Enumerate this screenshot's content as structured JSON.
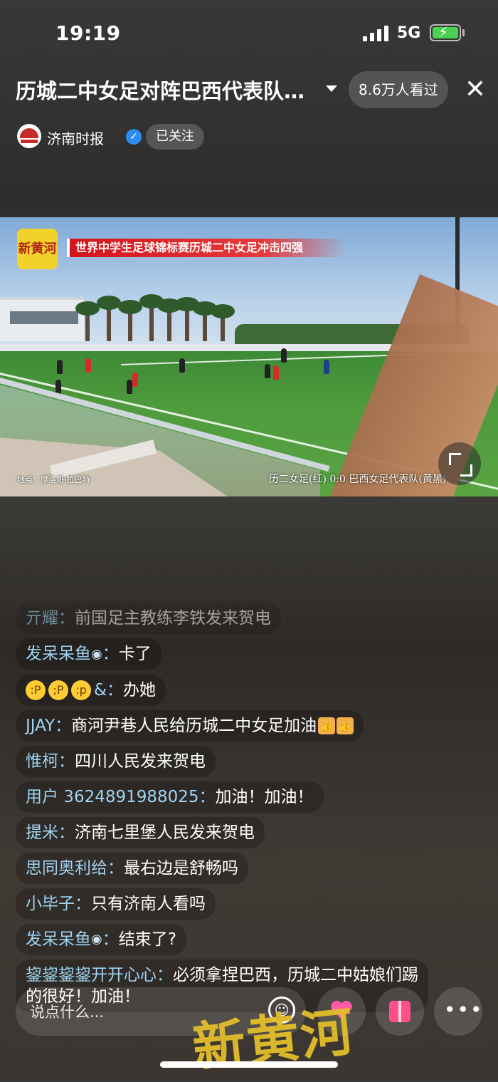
{
  "status_bar": {
    "time": "19:19",
    "network": "5G"
  },
  "header": {
    "title": "历城二中女足对阵巴西代表队…",
    "viewers": "8.6万人看过",
    "close_icon": "close-icon"
  },
  "channel": {
    "name": "济南时报",
    "follow_label": "已关注"
  },
  "video": {
    "logo_text": "新黄河",
    "headline": "世界中学生足球锦标赛历城二中女足冲击四强",
    "location": "地点：摩洛哥·拉巴特",
    "score": "历二女足(红) 0:0 巴西女足代表队(黄黑)"
  },
  "chat": [
    {
      "user": "亓耀",
      "text": "前国足主教练李铁发来贺电",
      "faded": true
    },
    {
      "user": "发呆呆鱼",
      "suffix_icon": "fish-icon",
      "text": "卡了"
    },
    {
      "user": "&",
      "prefix_emojis": [
        "crazy-face-emoji",
        "winking-tongue-emoji",
        "tongue-emoji"
      ],
      "text": "办她"
    },
    {
      "user": "JJAY",
      "text": "商河尹巷人民给历城二中女足加油",
      "suffix_icons": [
        "thumbs-up-icon",
        "thumbs-up-icon"
      ]
    },
    {
      "user": "惟柯",
      "text": "四川人民发来贺电"
    },
    {
      "user": "用户 3624891988025",
      "text": "加油！加油！"
    },
    {
      "user": "提米",
      "text": "济南七里堡人民发来贺电"
    },
    {
      "user": "思同奥利给",
      "text": "最右边是舒畅吗"
    },
    {
      "user": "小毕子",
      "text": "只有济南人看吗"
    },
    {
      "user": "发呆呆鱼",
      "suffix_icon": "fish-icon",
      "text": "结束了?"
    },
    {
      "user": "鋆鋆鋆鋆开开心心",
      "text": "必须拿捏巴西，历城二中姑娘们踢的很好！加油！"
    }
  ],
  "bottom_bar": {
    "placeholder": "说点什么..."
  },
  "watermark": "新黄河",
  "colors": {
    "username": "#9fd3f2",
    "follow_bg": "rgba(255,255,255,0.18)",
    "headline_red": "#d3141a",
    "logo_yellow": "#f2d12a",
    "watermark_gold": "#e3bd2a"
  }
}
